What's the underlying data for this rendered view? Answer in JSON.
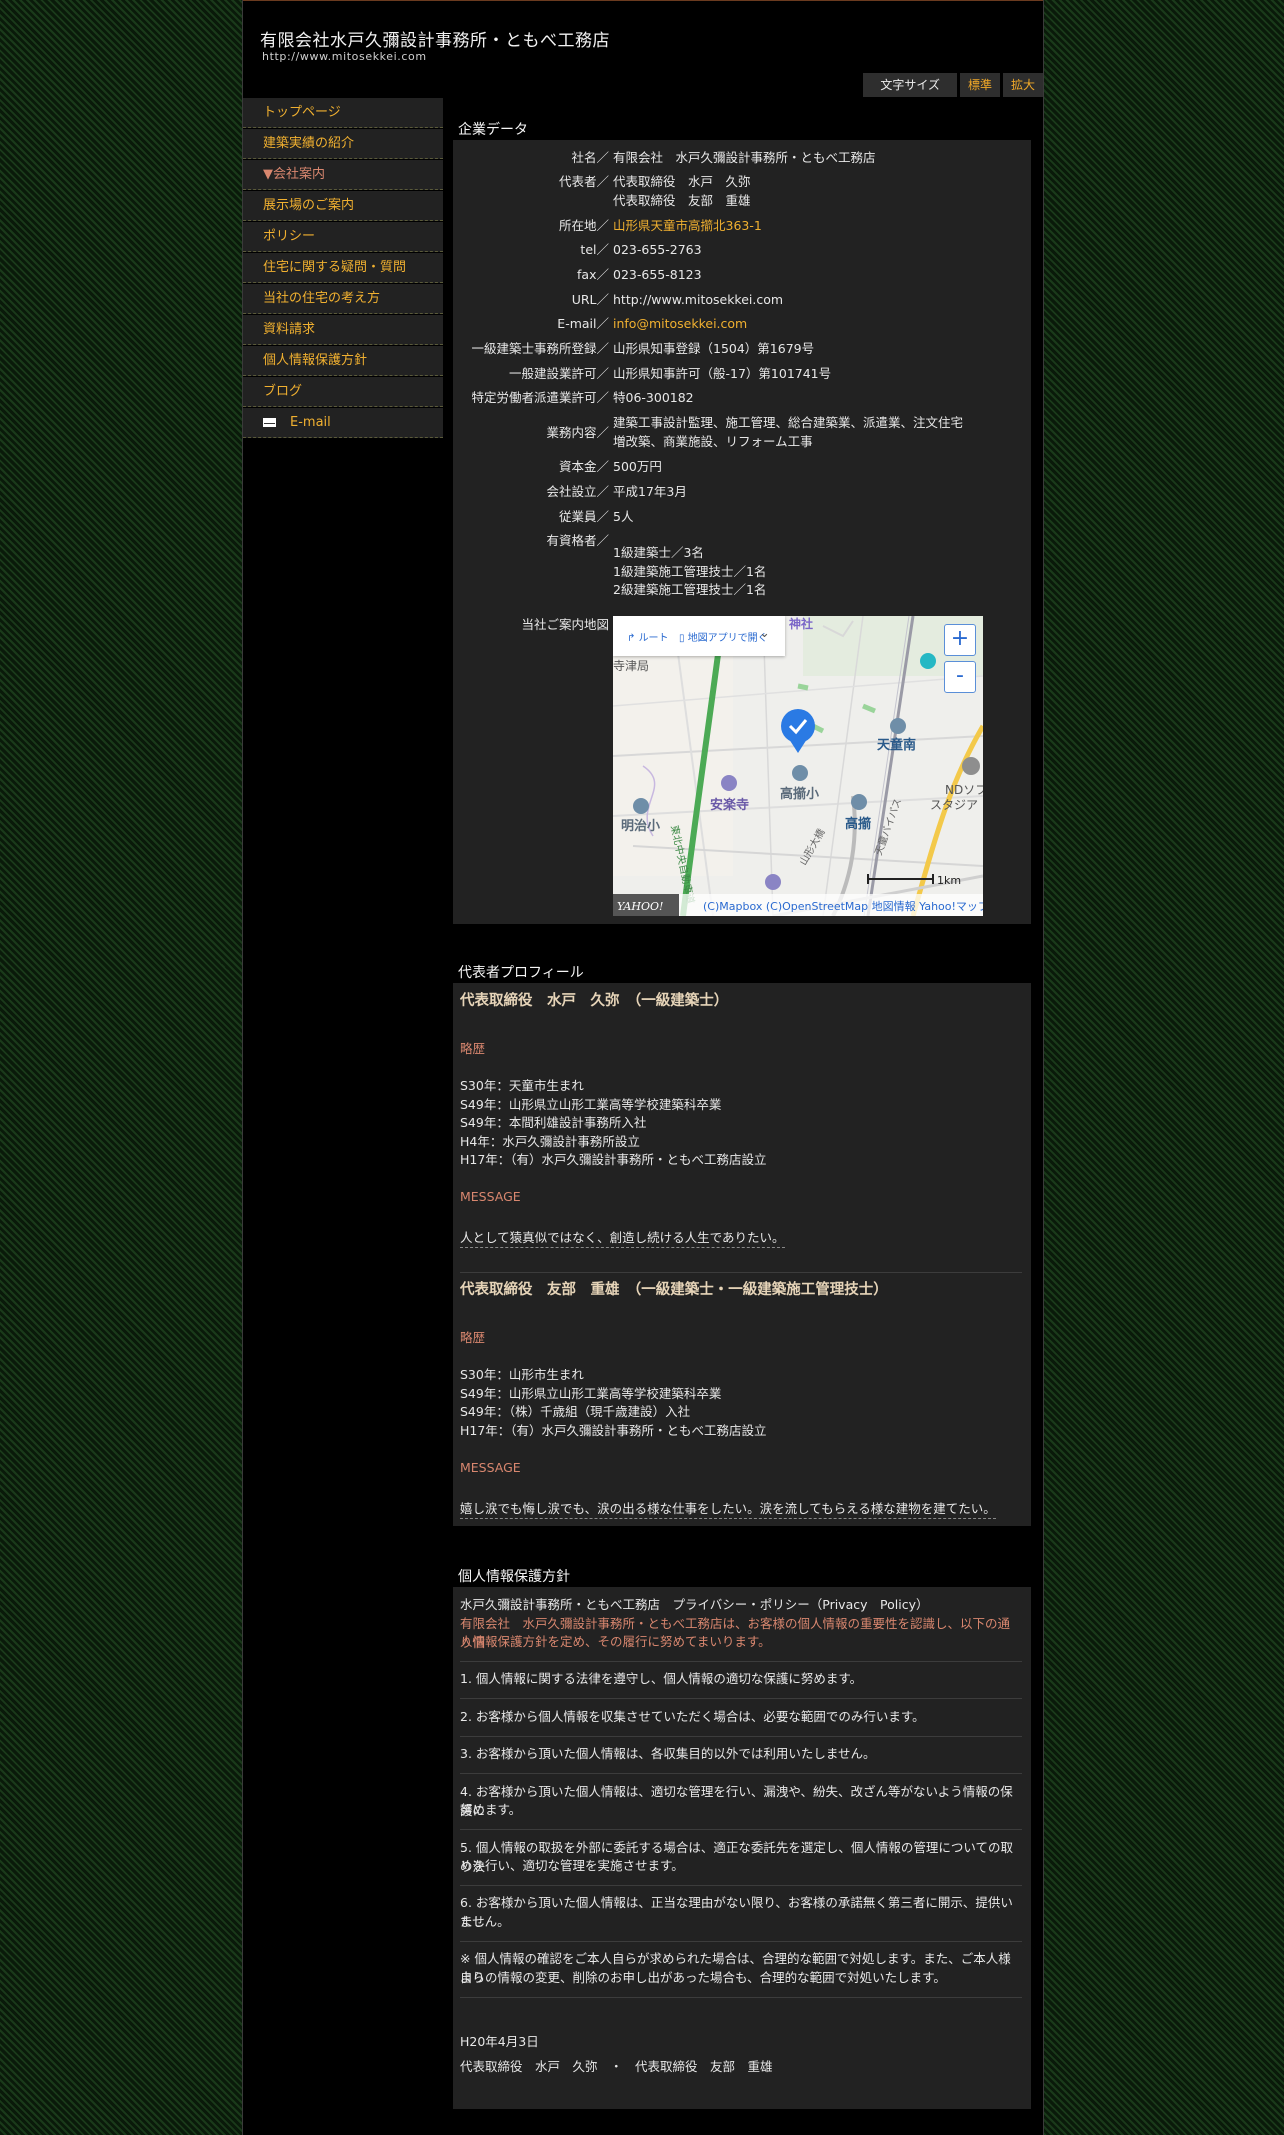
{
  "site": {
    "title": "有限会社水戸久彌設計事務所・ともべ工務店",
    "url": "http://www.mitosekkei.com"
  },
  "fontsize": {
    "label": "文字サイズ",
    "normal": "標準",
    "large": "拡大"
  },
  "sidebar": {
    "items": [
      {
        "label": "トップページ"
      },
      {
        "label": "建築実績の紹介"
      },
      {
        "label": "▼会社案内"
      },
      {
        "label": "展示場のご案内"
      },
      {
        "label": "ポリシー"
      },
      {
        "label": "住宅に関する疑問・質問"
      },
      {
        "label": "当社の住宅の考え方"
      },
      {
        "label": "資料請求"
      },
      {
        "label": "個人情報保護方針"
      },
      {
        "label": "ブログ"
      },
      {
        "label": "E-mail"
      }
    ]
  },
  "company": {
    "title": "企業データ",
    "rows": [
      {
        "label": "社名／",
        "value": "有限会社　水戸久彌設計事務所・ともべ工務店"
      },
      {
        "label": "代表者／",
        "value": "代表取締役　水戸　久弥",
        "value2": "代表取締役　友部　重雄"
      },
      {
        "label": "所在地／",
        "value": "山形県天童市高擶北363-1"
      },
      {
        "label": "tel／",
        "value": "023-655-2763"
      },
      {
        "label": "fax／",
        "value": "023-655-8123"
      },
      {
        "label": "URL／",
        "value": "http://www.mitosekkei.com"
      },
      {
        "label": "E-mail／",
        "value": "info@mitosekkei.com"
      },
      {
        "label": "一級建築士事務所登録／",
        "value": "山形県知事登録（1504）第1679号"
      },
      {
        "label": "一般建設業許可／",
        "value": "山形県知事許可（般-17）第101741号"
      },
      {
        "label": "特定労働者派遣業許可／",
        "value": "特06-300182"
      },
      {
        "label": "業務内容／",
        "value": "建築工事設計監理、施工管理、総合建築業、派遣業、注文住宅",
        "value2": "増改築、商業施設、リフォーム工事"
      },
      {
        "label": "資本金／",
        "value": "500万円"
      },
      {
        "label": "会社設立／",
        "value": "平成17年3月"
      },
      {
        "label": "従業員／",
        "value": "5人"
      },
      {
        "label": "有資格者／",
        "value": "1級建築士／3名",
        "value2": "1級建築施工管理技士／1名",
        "value3": "2級建築施工管理技士／1名"
      },
      {
        "label": "当社ご案内地図"
      }
    ]
  },
  "map": {
    "route": "ルート",
    "mapapp": "地図アプリで開く",
    "labels": [
      "神社",
      "寺津局",
      "天童南",
      "NDソフト",
      "スタジア",
      "高擶小",
      "安楽寺",
      "明治小",
      "高擶",
      "東北中央自動車道",
      "山形大橋",
      "天童バイパス"
    ],
    "scale": "1km",
    "logo": "YAHOO! JAPAN",
    "attribution": "(C)Mapbox  (C)OpenStreetMap  地図情報  Yahoo!マップの使い方"
  },
  "profile": {
    "title": "代表者プロフィール",
    "people": [
      {
        "name": "代表取締役　水戸　久弥　（一級建築士）",
        "career_label": "略歴",
        "career": [
          "S30年：天童市生まれ",
          "S49年：山形県立山形工業高等学校建築科卒業",
          "S49年：本間利雄設計事務所入社",
          "H4年：水戸久彌設計事務所設立",
          "H17年：（有）水戸久彌設計事務所・ともべ工務店設立"
        ],
        "message_label": "MESSAGE",
        "message": "人として猿真似ではなく、創造し続ける人生でありたい。"
      },
      {
        "name": "代表取締役　友部　重雄　（一級建築士・一級建築施工管理技士）",
        "career_label": "略歴",
        "career": [
          "S30年：山形市生まれ",
          "S49年：山形県立山形工業高等学校建築科卒業",
          "S49年：（株）千歳組（現千歳建設）入社",
          "H17年：（有）水戸久彌設計事務所・ともべ工務店設立"
        ],
        "message_label": "MESSAGE",
        "message": "嬉し涙でも悔し涙でも、涙の出る様な仕事をしたい。涙を流してもらえる様な建物を建てたい。"
      }
    ]
  },
  "privacy": {
    "title": "個人情報保護方針",
    "heading": "水戸久彌設計事務所・ともべ工務店　プライバシー・ポリシー（Privacy　Policy）",
    "intro": [
      "有限会社　水戸久彌設計事務所・ともべ工務店は、お客様の個人情報の重要性を認識し、以下の通り個",
      "人情報保護方針を定め、その履行に努めてまいります。"
    ],
    "items": [
      [
        "1. 個人情報に関する法律を遵守し、個人情報の適切な保護に努めます。"
      ],
      [
        "2. お客様から個人情報を収集させていただく場合は、必要な範囲でのみ行います。"
      ],
      [
        "3. お客様から頂いた個人情報は、各収集目的以外では利用いたしません。"
      ],
      [
        "4. お客様から頂いた個人情報は、適切な管理を行い、漏洩や、紛失、改ざん等がないよう情報の保護に",
        "努めます。"
      ],
      [
        "5. 個人情報の取扱を外部に委託する場合は、適正な委託先を選定し、個人情報の管理についての取り決",
        "めを行い、適切な管理を実施させます。"
      ],
      [
        "6. お客様から頂いた個人情報は、正当な理由がない限り、お客様の承諾無く第三者に開示、提供いたし",
        "ません。"
      ],
      [
        "※ 個人情報の確認をご本人自らが求められた場合は、合理的な範囲で対処します。また、ご本人様より",
        "自らの情報の変更、削除のお申し出があった場合も、合理的な範囲で対処いたします。"
      ]
    ],
    "date": "H20年4月3日",
    "signature": "代表取締役　水戸　久弥　・　代表取締役　友部　重雄"
  }
}
